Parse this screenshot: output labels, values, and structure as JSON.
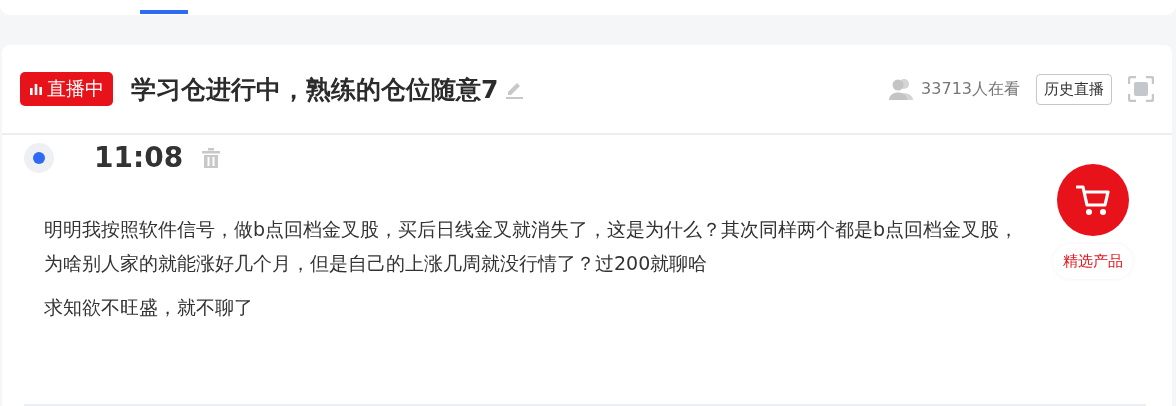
{
  "live_header": {
    "badge": "直播中",
    "title": "学习仓进行中，熟练的仓位随意7",
    "viewers": "33713人在看",
    "history_button": "历史直播"
  },
  "posts": [
    {
      "time": "11:08",
      "active": true,
      "paragraphs": [
        "明明我按照软件信号，做b点回档金叉股，买后日线金叉就消失了，这是为什么？其次同样两个都是b点回档金叉股，为啥别人家的就能涨好几个月，但是自己的上涨几周就没行情了？过200就聊哈",
        "求知欲不旺盛，就不聊了"
      ]
    }
  ],
  "product_button": {
    "label": "精选产品"
  }
}
